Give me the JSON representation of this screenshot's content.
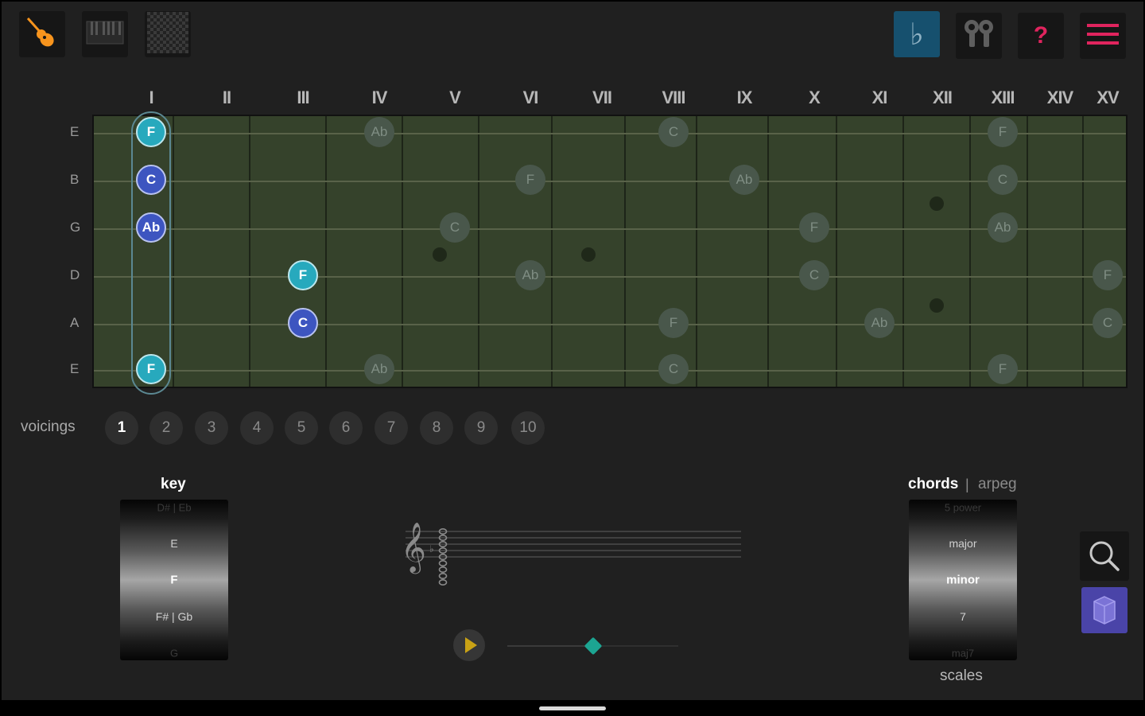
{
  "toolbar": {
    "left": [
      {
        "name": "guitar-mode-icon",
        "color": "#f7941d"
      },
      {
        "name": "piano-mode-icon"
      },
      {
        "name": "grid-mode-icon"
      }
    ],
    "right": [
      {
        "name": "flat-sharp-toggle-icon",
        "glyph": "♭",
        "active": true
      },
      {
        "name": "tuning-pegs-icon"
      },
      {
        "name": "help-icon",
        "glyph": "?",
        "color": "#e0245e"
      },
      {
        "name": "menu-icon",
        "color": "#e0245e"
      }
    ]
  },
  "fret_numerals": [
    "I",
    "II",
    "III",
    "IV",
    "V",
    "VI",
    "VII",
    "VIII",
    "IX",
    "X",
    "XI",
    "XII",
    "XIII",
    "XIV",
    "XV"
  ],
  "strings": [
    "E",
    "B",
    "G",
    "D",
    "A",
    "E"
  ],
  "fretboard": {
    "bg_color": "#35422b",
    "inlay_frets": [
      5,
      7,
      12,
      12
    ],
    "voicing_fret": 1,
    "notes": [
      {
        "string": 0,
        "fret": 1,
        "label": "F",
        "style": "teal"
      },
      {
        "string": 0,
        "fret": 4,
        "label": "Ab",
        "style": "ghost"
      },
      {
        "string": 0,
        "fret": 8,
        "label": "C",
        "style": "ghost"
      },
      {
        "string": 0,
        "fret": 13,
        "label": "F",
        "style": "ghost"
      },
      {
        "string": 1,
        "fret": 1,
        "label": "C",
        "style": "blue"
      },
      {
        "string": 1,
        "fret": 6,
        "label": "F",
        "style": "ghost"
      },
      {
        "string": 1,
        "fret": 9,
        "label": "Ab",
        "style": "ghost"
      },
      {
        "string": 1,
        "fret": 13,
        "label": "C",
        "style": "ghost"
      },
      {
        "string": 2,
        "fret": 1,
        "label": "Ab",
        "style": "blue"
      },
      {
        "string": 2,
        "fret": 5,
        "label": "C",
        "style": "ghost"
      },
      {
        "string": 2,
        "fret": 10,
        "label": "F",
        "style": "ghost"
      },
      {
        "string": 2,
        "fret": 13,
        "label": "Ab",
        "style": "ghost"
      },
      {
        "string": 3,
        "fret": 3,
        "label": "F",
        "style": "teal"
      },
      {
        "string": 3,
        "fret": 6,
        "label": "Ab",
        "style": "ghost"
      },
      {
        "string": 3,
        "fret": 10,
        "label": "C",
        "style": "ghost"
      },
      {
        "string": 3,
        "fret": 15,
        "label": "F",
        "style": "ghost"
      },
      {
        "string": 4,
        "fret": 3,
        "label": "C",
        "style": "blue"
      },
      {
        "string": 4,
        "fret": 8,
        "label": "F",
        "style": "ghost"
      },
      {
        "string": 4,
        "fret": 11,
        "label": "Ab",
        "style": "ghost"
      },
      {
        "string": 4,
        "fret": 15,
        "label": "C",
        "style": "ghost"
      },
      {
        "string": 5,
        "fret": 1,
        "label": "F",
        "style": "teal"
      },
      {
        "string": 5,
        "fret": 4,
        "label": "Ab",
        "style": "ghost"
      },
      {
        "string": 5,
        "fret": 8,
        "label": "C",
        "style": "ghost"
      },
      {
        "string": 5,
        "fret": 13,
        "label": "F",
        "style": "ghost"
      }
    ]
  },
  "voicings": {
    "label": "voicings",
    "items": [
      "1",
      "2",
      "3",
      "4",
      "5",
      "6",
      "7",
      "8",
      "9",
      "10"
    ],
    "selected": 0
  },
  "key": {
    "title": "key",
    "items": [
      "D# | Eb",
      "E",
      "F",
      "F# | Gb",
      "G"
    ],
    "selected": 2
  },
  "chords": {
    "title": "chords",
    "separator": "|",
    "alt": "arpeg",
    "items": [
      "5 power",
      "major",
      "minor",
      "7",
      "maj7"
    ],
    "selected": 2,
    "footer": "scales"
  },
  "playback": {
    "progress": 0.5,
    "accent": "#1ca592"
  }
}
